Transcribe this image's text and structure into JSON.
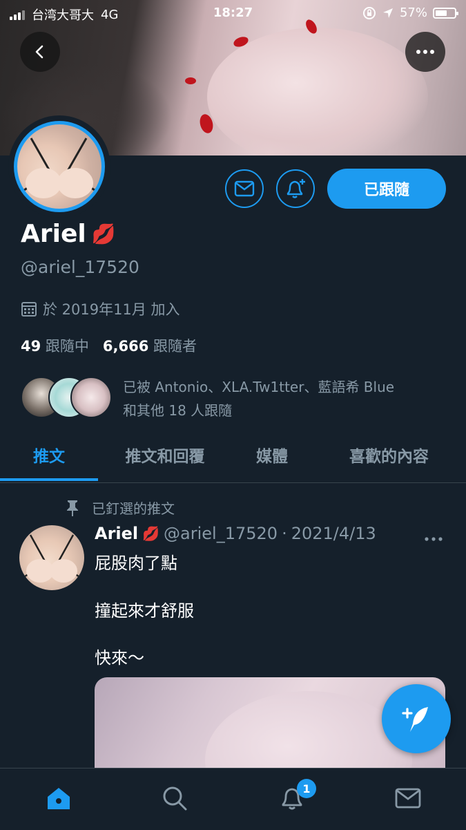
{
  "status_bar": {
    "carrier": "台湾大哥大",
    "network": "4G",
    "time": "18:27",
    "battery": "57%"
  },
  "profile": {
    "name": "Ariel",
    "name_emoji": "💋",
    "handle": "@ariel_17520",
    "joined": "於 2019年11月 加入",
    "following_count": "49",
    "following_label": "跟隨中",
    "followers_count": "6,666",
    "followers_label": "跟隨者",
    "followed_by_line1": "已被 Antonio、XLA.Tw1tter、藍語希 Blue",
    "followed_by_line2": "和其他 18 人跟隨",
    "follow_button": "已跟隨"
  },
  "tabs": [
    {
      "label": "推文",
      "active": true
    },
    {
      "label": "推文和回覆",
      "active": false
    },
    {
      "label": "媒體",
      "active": false
    },
    {
      "label": "喜歡的內容",
      "active": false
    }
  ],
  "pinned_tweet": {
    "pinned_label": "已釘選的推文",
    "author": "Ariel",
    "author_emoji": "💋",
    "handle": "@ariel_17520",
    "separator": "·",
    "date": "2021/4/13",
    "lines": [
      "屁股肉了點",
      "撞起來才舒服",
      "快來～"
    ]
  },
  "bottom_nav": {
    "notifications_badge": "1"
  },
  "colors": {
    "background": "#15202b",
    "accent": "#1d9bf0",
    "muted": "#8899a6",
    "divider": "#38444d"
  },
  "icons": [
    "back-arrow-icon",
    "more-icon",
    "mail-icon",
    "bell-plus-icon",
    "calendar-icon",
    "pin-icon",
    "compose-icon",
    "home-icon",
    "search-icon",
    "bell-icon",
    "envelope-icon"
  ]
}
